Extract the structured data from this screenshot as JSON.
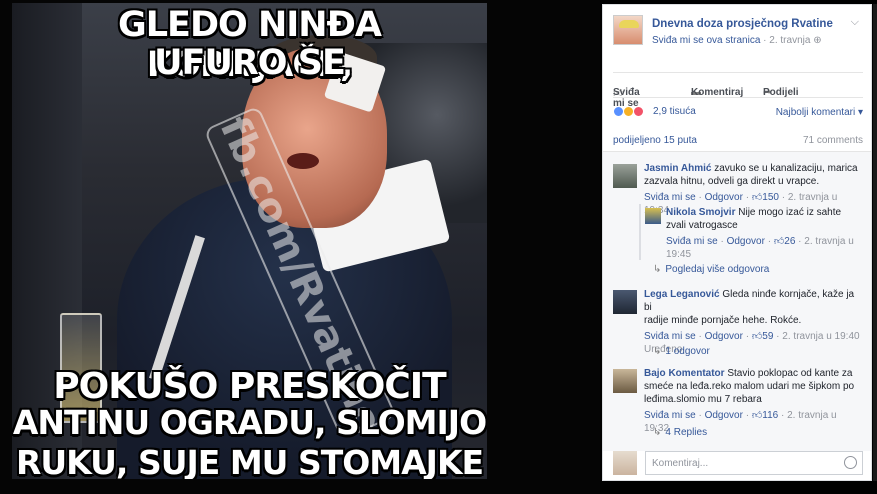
{
  "meme": {
    "top_line1": "GLEDO NINĐA KORNJAČE,",
    "top_line2": "UFURO SE",
    "bottom_line1": "POKUŠO PRESKOČIT",
    "bottom_line2": "ANTINU OGRADU, SLOMIJO",
    "bottom_line3": "RUKU, SUJE MU STOMAJKE",
    "watermark": "fb.com/Rvatine"
  },
  "post": {
    "page_name": "Dnevna doza prosječnog Rvatine",
    "like_page": "Sviđa mi se ova stranica",
    "date": "2. travnja",
    "privacy_icon": "globe-icon",
    "menu_icon": "chevron-down-icon"
  },
  "actions": {
    "like": "Sviđa mi se",
    "comment": "Komentiraj",
    "share": "Podijeli"
  },
  "reactions": {
    "count": "2,9 tisuća",
    "sort": "Najbolji komentari",
    "colors": {
      "like": "#5890ff",
      "haha": "#f7b125",
      "love": "#f25268"
    }
  },
  "stats": {
    "shares": "podijeljeno 15 puta",
    "comments": "71 comments"
  },
  "comments": [
    {
      "name": "Jasmin Ahmić",
      "text1": "zavuko se u kanalizaciju, marica",
      "text2": "zazvala hitnu, odveli ga direkt u vrapce.",
      "like": "Sviđa mi se",
      "reply": "Odgovor",
      "likes": "150",
      "time": "2. travnja u 19:34"
    },
    {
      "name": "Nikola Smojvir",
      "text1": "Nije mogo izać iz sahte",
      "text2": "zvali vatrogasce",
      "like": "Sviđa mi se",
      "reply": "Odgovor",
      "likes": "26",
      "time": "2. travnja u",
      "time2": "19:45"
    },
    {
      "name": "Lega Leganović",
      "text1": "Gleda ninđe kornjače, kaže ja bi",
      "text2": "radije minđe pornjače hehe. Rokće.",
      "like": "Sviđa mi se",
      "reply": "Odgovor",
      "likes": "59",
      "time": "2. travnja u 19:40",
      "edited": "Uređeno"
    },
    {
      "name": "Bajo Komentator",
      "text1": "Stavio poklopac od kante za",
      "text2": "smeće na leđa.reko malom udari me šipkom po",
      "text3": "leđima.slomio mu 7 rebara",
      "like": "Sviđa mi se",
      "reply": "Odgovor",
      "likes": "116",
      "time": "2. travnja u 19:32"
    }
  ],
  "replies": {
    "more": "Pogledaj više odgovora",
    "one": "1 odgovor",
    "four": "4 Replies"
  },
  "composer": {
    "placeholder": "Komentiraj..."
  }
}
